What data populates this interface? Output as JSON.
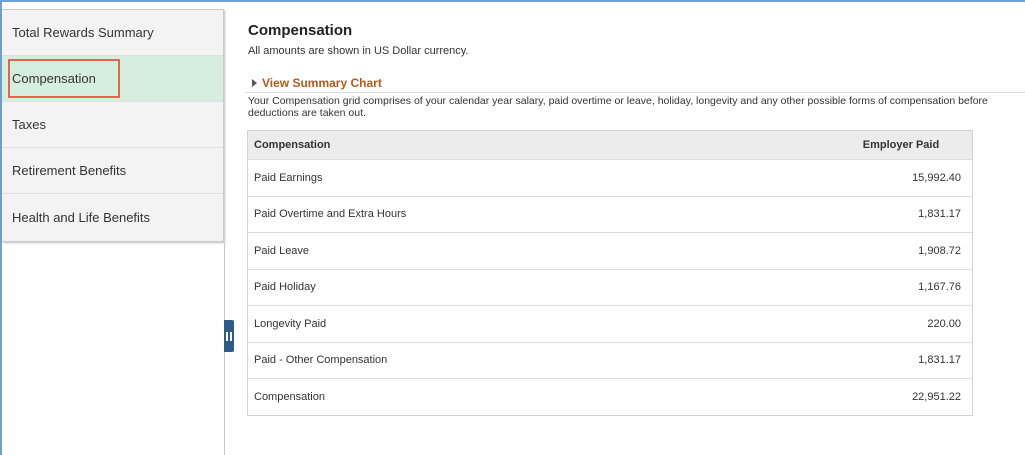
{
  "sidebar": {
    "items": [
      {
        "label": "Total Rewards Summary",
        "active": false
      },
      {
        "label": "Compensation",
        "active": true
      },
      {
        "label": "Taxes",
        "active": false
      },
      {
        "label": "Retirement Benefits",
        "active": false
      },
      {
        "label": "Health and Life Benefits",
        "active": false
      }
    ]
  },
  "main": {
    "title": "Compensation",
    "subtitle": "All amounts are shown in US Dollar currency.",
    "chart_link": "View Summary Chart",
    "description": "Your Compensation grid comprises of your calendar year salary, paid overtime or leave, holiday, longevity and any other possible forms of compensation before deductions are taken out.",
    "grid": {
      "columns": [
        "Compensation",
        "Employer Paid"
      ],
      "rows": [
        {
          "name": "Paid Earnings",
          "amount": "15,992.40"
        },
        {
          "name": "Paid Overtime and Extra Hours",
          "amount": "1,831.17"
        },
        {
          "name": "Paid Leave",
          "amount": "1,908.72"
        },
        {
          "name": "Paid Holiday",
          "amount": "1,167.76"
        },
        {
          "name": "Longevity Paid",
          "amount": "220.00"
        },
        {
          "name": "Paid - Other Compensation",
          "amount": "1,831.17"
        },
        {
          "name": "Compensation",
          "amount": "22,951.22"
        }
      ]
    }
  },
  "colors": {
    "active_bg": "#d6eede",
    "highlight_border": "#e0664f",
    "link": "#b25b1c",
    "collapse_tab": "#2d5b8a",
    "frame": "#6f9fd8"
  },
  "icons": {
    "collapse": "pause-bars-icon",
    "expand": "triangle-right-icon"
  }
}
